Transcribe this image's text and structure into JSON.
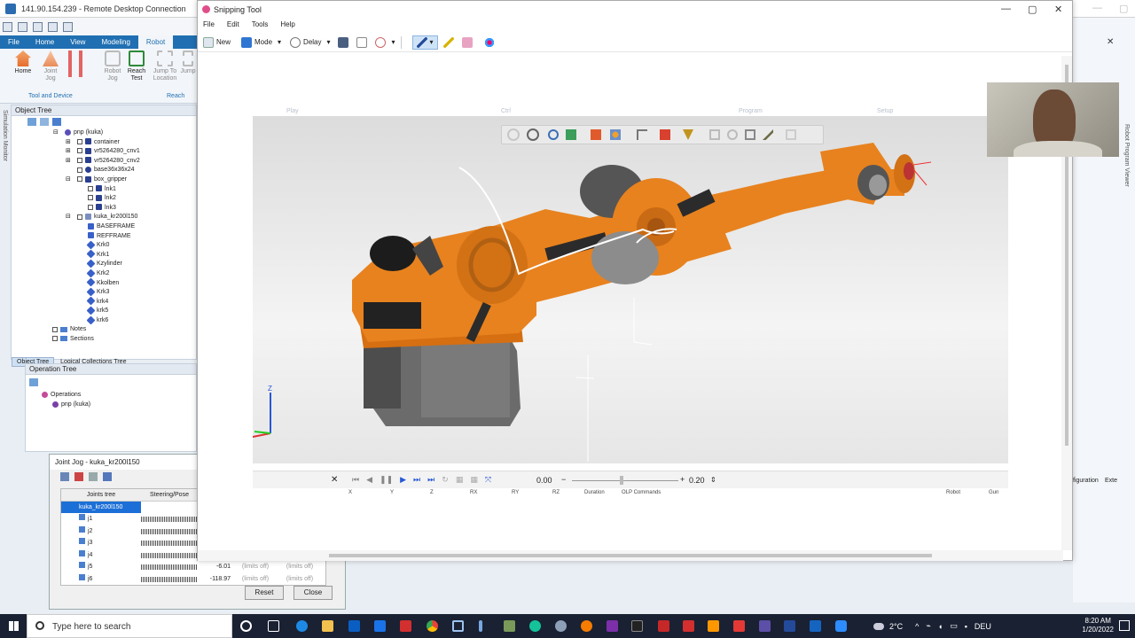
{
  "rdc": {
    "title": "141.90.154.239 - Remote Desktop Connection",
    "ribbon_tabs": [
      "File",
      "Home",
      "View",
      "Modeling",
      "Robot"
    ],
    "ribbon_buttons": [
      {
        "label": "Home",
        "sub": ""
      },
      {
        "label": "Joint",
        "sub": "Jog"
      },
      {
        "label": "",
        "sub": ""
      },
      {
        "label": "Robot",
        "sub": "Jog"
      },
      {
        "label": "Reach",
        "sub": "Test"
      },
      {
        "label": "Jump To",
        "sub": "Location"
      },
      {
        "label": "Jump",
        "sub": ""
      }
    ],
    "group_labels": [
      "Tool and Device",
      "Reach"
    ]
  },
  "object_tree": {
    "title": "Object Tree",
    "side_label": "Simulation Monitor",
    "items": [
      {
        "label": "pnp (kuka)",
        "depth": 0,
        "kind": "root"
      },
      {
        "label": "container",
        "depth": 1,
        "kind": "part"
      },
      {
        "label": "vr5264280_cnv1",
        "depth": 1,
        "kind": "part"
      },
      {
        "label": "vr5264280_cnv2",
        "depth": 1,
        "kind": "part"
      },
      {
        "label": "base36x36x24",
        "depth": 1,
        "kind": "dot"
      },
      {
        "label": "box_gripper",
        "depth": 1,
        "kind": "part"
      },
      {
        "label": "lnk1",
        "depth": 2,
        "kind": "part"
      },
      {
        "label": "lnk2",
        "depth": 2,
        "kind": "part"
      },
      {
        "label": "lnk3",
        "depth": 2,
        "kind": "part"
      },
      {
        "label": "kuka_kr200l150",
        "depth": 1,
        "kind": "robot"
      },
      {
        "label": "BASEFRAME",
        "depth": 2,
        "kind": "frame"
      },
      {
        "label": "REFFRAME",
        "depth": 2,
        "kind": "frame"
      },
      {
        "label": "Krk0",
        "depth": 2,
        "kind": "link"
      },
      {
        "label": "Krk1",
        "depth": 2,
        "kind": "link"
      },
      {
        "label": "Kzylinder",
        "depth": 2,
        "kind": "link"
      },
      {
        "label": "Krk2",
        "depth": 2,
        "kind": "link"
      },
      {
        "label": "Kkolben",
        "depth": 2,
        "kind": "link"
      },
      {
        "label": "Krk3",
        "depth": 2,
        "kind": "link"
      },
      {
        "label": "krk4",
        "depth": 2,
        "kind": "link"
      },
      {
        "label": "krk5",
        "depth": 2,
        "kind": "link"
      },
      {
        "label": "krk6",
        "depth": 2,
        "kind": "link"
      },
      {
        "label": "Notes",
        "depth": 0,
        "kind": "folder"
      },
      {
        "label": "Sections",
        "depth": 0,
        "kind": "folder"
      }
    ],
    "tabs": [
      "Object Tree",
      "Logical Collections Tree"
    ]
  },
  "operation_tree": {
    "title": "Operation Tree",
    "items": [
      {
        "label": "Operations",
        "depth": 0
      },
      {
        "label": "pnp (kuka)",
        "depth": 1
      }
    ]
  },
  "joint_jog": {
    "title": "Joint Jog - kuka_kr200l150",
    "col_joints": "Joints tree",
    "col_steering": "Steering/Pose",
    "robot": "kuka_kr200l150",
    "joints": [
      {
        "name": "j1",
        "value": "",
        "lo": "",
        "hi": ""
      },
      {
        "name": "j2",
        "value": "",
        "lo": "",
        "hi": ""
      },
      {
        "name": "j3",
        "value": "",
        "lo": "",
        "hi": ""
      },
      {
        "name": "j4",
        "value": "",
        "lo": "",
        "hi": ""
      },
      {
        "name": "j5",
        "value": "-6.01",
        "lo": "(limits off)",
        "hi": "(limits off)"
      },
      {
        "name": "j6",
        "value": "-118.97",
        "lo": "(limits off)",
        "hi": "(limits off)"
      }
    ],
    "reset": "Reset",
    "close": "Close"
  },
  "right_panel": {
    "vertical_label": "Robot Program Viewer",
    "configuration": "figuration",
    "exte": "Exte"
  },
  "snip": {
    "title": "Snipping Tool",
    "menu": [
      "File",
      "Edit",
      "Tools",
      "Help"
    ],
    "new": "New",
    "mode": "Mode",
    "delay": "Delay",
    "faint_labels": [
      "Play",
      "Ctrl",
      "Program",
      "Setup"
    ],
    "time_value": "0.00",
    "speed_value": "0.20",
    "columns": [
      "X",
      "Y",
      "Z",
      "RX",
      "RY",
      "RZ",
      "Duration",
      "OLP Commands",
      "Robot",
      "Gun"
    ]
  },
  "taskbar": {
    "search_placeholder": "Type here to search",
    "temperature": "2°C",
    "language": "DEU",
    "time": "8:20 AM",
    "date": "1/20/2022"
  },
  "colors": {
    "robot_orange": "#e8821e",
    "ribbon_blue": "#1f6fb2",
    "taskbar": "#1a2133"
  }
}
